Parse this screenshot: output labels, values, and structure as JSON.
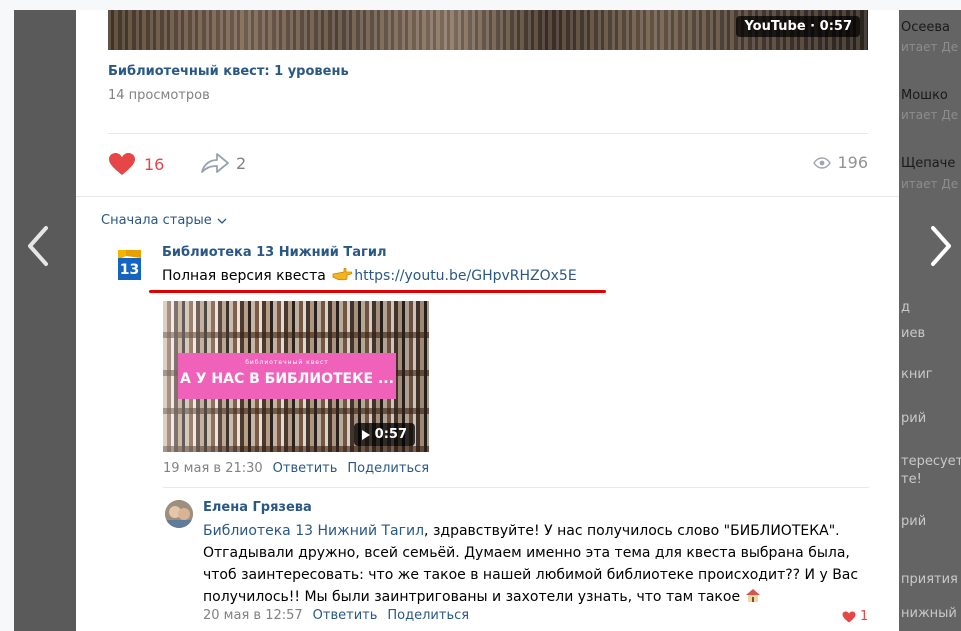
{
  "post": {
    "video_badge": "YouTube · 0:57",
    "title": "Библиотечный квест: 1 уровень",
    "views_text": "14 просмотров",
    "likes": "16",
    "shares": "2",
    "views": "196"
  },
  "comments_header": {
    "sort_label": "Сначала старые"
  },
  "comment1": {
    "author": "Библиотека 13 Нижний Тагил",
    "text": "Полная версия квеста",
    "link": "https://youtu.be/GHpvRHZOx5E",
    "avatar_text": "13",
    "video_small_text": "библиотечный квест",
    "video_title": "А У НАС В БИБЛИОТЕКЕ ...",
    "video_duration": "0:57",
    "date": "19 мая в 21:30",
    "reply_label": "Ответить",
    "share_label": "Поделиться"
  },
  "comment2": {
    "author": "Елена Грязева",
    "mention": "Библиотека 13 Нижний Тагил",
    "text": ", здравствуйте! У нас получилось слово \"БИБЛИОТЕКА\". Отгадывали дружно, всей семьёй. Думаем именно эта тема для квеста выбрана была, чтоб заинтересовать: что же такое в нашей любимой библиотеке происходит?? И у Вас получилось!! Мы были заинтригованы и захотели узнать, что там такое",
    "date": "20 мая в 12:57",
    "reply_label": "Ответить",
    "share_label": "Поделиться",
    "likes": "1"
  },
  "side_ghost": {
    "items": [
      "Осеева",
      "Мошко",
      "Щепаче",
      "д",
      "иев",
      "книг",
      "рий",
      "тересует",
      "те!",
      "рий",
      "приятия",
      "нижный"
    ],
    "subs": [
      "итает Де",
      "итает Де",
      "итает Де"
    ]
  },
  "colors": {
    "link": "#2a5885",
    "like_red": "#e64646",
    "underline_red": "#e00000",
    "pink_banner": "#f062b9"
  }
}
